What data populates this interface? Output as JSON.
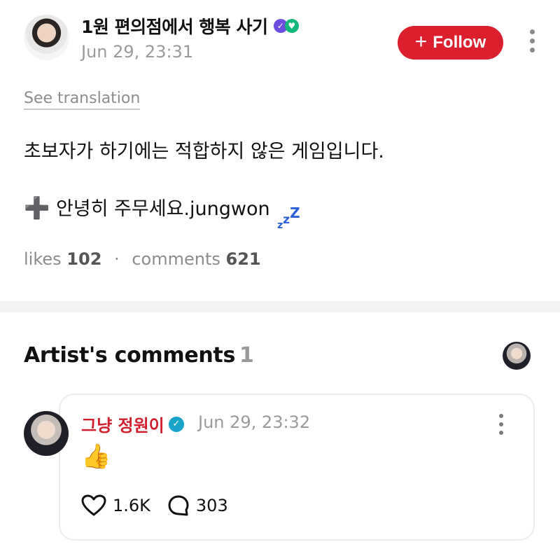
{
  "post": {
    "author_name": "1원 편의점에서 행복 사기",
    "timestamp": "Jun 29, 23:31",
    "follow_label": "Follow",
    "see_translation": "See translation",
    "body_line1": "초보자가 하기에는 적합하지 않은 게임입니다.",
    "body_line2": "안녕히 주무세요.jungwon",
    "likes_label": "likes",
    "likes_count": "102",
    "comments_label": "comments",
    "comments_count": "621"
  },
  "artist_comments": {
    "title": "Artist's comments",
    "count": "1",
    "comment": {
      "author": "그냥 정원이",
      "timestamp": "Jun 29, 23:32",
      "content": "👍",
      "likes": "1.6K",
      "replies": "303"
    }
  },
  "icons": [
    "avatar",
    "verified-badge-icon",
    "plus-icon",
    "kebab-menu-icon",
    "heart-icon",
    "comment-bubble-icon",
    "zzz-icon"
  ],
  "colors": {
    "accent": "#db1f2d",
    "muted": "#9a9a9a",
    "verified": "#1aa3c8"
  }
}
